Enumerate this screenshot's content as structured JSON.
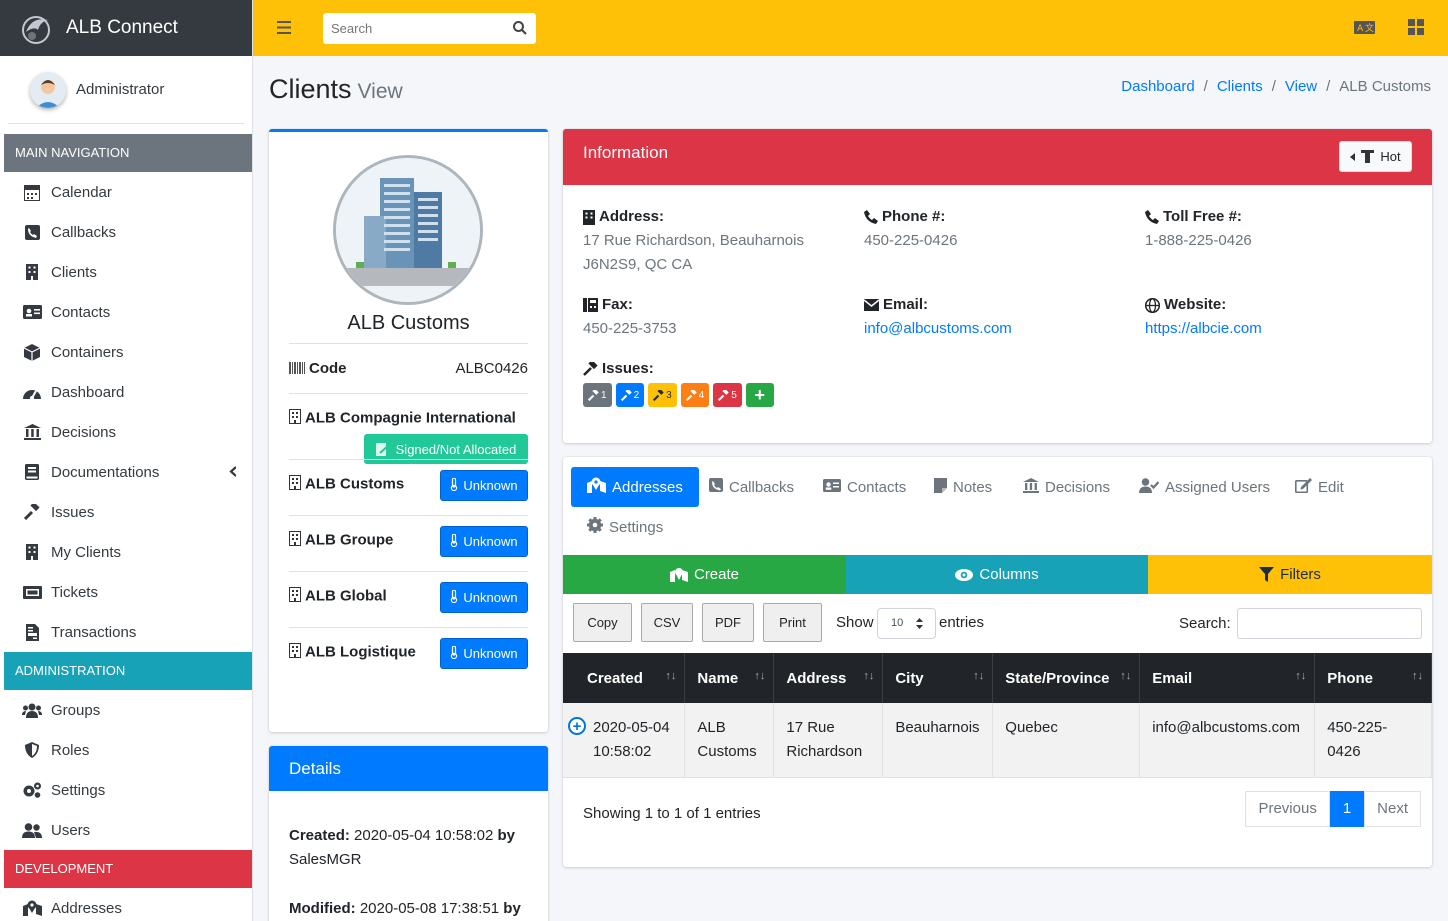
{
  "app": {
    "title": "ALB Connect"
  },
  "user": {
    "name": "Administrator"
  },
  "sidebar": {
    "main_header": "MAIN NAVIGATION",
    "main_items": [
      {
        "label": "Calendar",
        "icon": "calendar-icon"
      },
      {
        "label": "Callbacks",
        "icon": "phone-square-icon"
      },
      {
        "label": "Clients",
        "icon": "building-icon"
      },
      {
        "label": "Contacts",
        "icon": "id-card-icon"
      },
      {
        "label": "Containers",
        "icon": "box-icon"
      },
      {
        "label": "Dashboard",
        "icon": "tachometer-icon"
      },
      {
        "label": "Decisions",
        "icon": "landmark-icon"
      },
      {
        "label": "Documentations",
        "icon": "book-icon"
      },
      {
        "label": "Issues",
        "icon": "gavel-icon"
      },
      {
        "label": "My Clients",
        "icon": "building-icon"
      },
      {
        "label": "Tickets",
        "icon": "ticket-icon"
      },
      {
        "label": "Transactions",
        "icon": "file-invoice-icon"
      }
    ],
    "admin_header": "ADMINISTRATION",
    "admin_items": [
      {
        "label": "Groups",
        "icon": "users-icon"
      },
      {
        "label": "Roles",
        "icon": "shield-icon"
      },
      {
        "label": "Settings",
        "icon": "cogs-icon"
      },
      {
        "label": "Users",
        "icon": "user-friends-icon"
      }
    ],
    "dev_header": "DEVELOPMENT",
    "dev_items": [
      {
        "label": "Addresses",
        "icon": "map-marked-icon"
      }
    ]
  },
  "topbar": {
    "search_placeholder": "Search"
  },
  "page": {
    "title": "Clients",
    "subtitle": "View"
  },
  "breadcrumb": [
    "Dashboard",
    "Clients",
    "View",
    "ALB Customs"
  ],
  "profile": {
    "name": "ALB Customs",
    "code_label": "Code",
    "code_value": "ALBC0426",
    "parent": "ALB Compagnie International",
    "parent_status": "Signed/Not Allocated",
    "related": [
      {
        "name": "ALB Customs",
        "status": "Unknown"
      },
      {
        "name": "ALB Groupe",
        "status": "Unknown"
      },
      {
        "name": "ALB Global",
        "status": "Unknown"
      },
      {
        "name": "ALB Logistique",
        "status": "Unknown"
      }
    ]
  },
  "details": {
    "title": "Details",
    "created_label": "Created:",
    "created_value": "2020-05-04 10:58:02",
    "created_by_label": "by",
    "created_by": "SalesMGR",
    "modified_label": "Modified:",
    "modified_value": "2020-05-08 17:38:51",
    "modified_by_label": "by"
  },
  "info": {
    "title": "Information",
    "hot_label": "Hot",
    "address_label": "Address:",
    "address_line1": "17 Rue Richardson, Beauharnois",
    "address_line2": "J6N2S9, QC CA",
    "phone_label": "Phone #:",
    "phone": "450-225-0426",
    "tollfree_label": "Toll Free #:",
    "tollfree": "1-888-225-0426",
    "fax_label": "Fax:",
    "fax": "450-225-3753",
    "email_label": "Email:",
    "email": "info@albcustoms.com",
    "website_label": "Website:",
    "website": "https://albcie.com",
    "issues_label": "Issues:",
    "issues": [
      {
        "n": "1",
        "color": "#6c757d"
      },
      {
        "n": "2",
        "color": "#007bff"
      },
      {
        "n": "3",
        "color": "#ffc107"
      },
      {
        "n": "4",
        "color": "#fd7e14"
      },
      {
        "n": "5",
        "color": "#dc3545"
      }
    ],
    "issue_add": "+"
  },
  "tabs": {
    "items": [
      "Addresses",
      "Callbacks",
      "Contacts",
      "Notes",
      "Decisions",
      "Assigned Users",
      "Edit",
      "Settings"
    ],
    "active": "Addresses",
    "actions": {
      "create": "Create",
      "columns": "Columns",
      "filters": "Filters"
    },
    "buttons": [
      "Copy",
      "CSV",
      "PDF",
      "Print"
    ],
    "show_label": "Show",
    "page_size": "10",
    "entries_label": "entries",
    "search_label": "Search:",
    "columns": [
      "Created",
      "Name",
      "Address",
      "City",
      "State/Province",
      "Email",
      "Phone"
    ],
    "rows": [
      {
        "created_line1": "2020-05-04",
        "created_line2": "10:58:02",
        "name_line1": "ALB",
        "name_line2": "Customs",
        "address_line1": "17 Rue",
        "address_line2": "Richardson",
        "city": "Beauharnois",
        "state": "Quebec",
        "email": "info@albcustoms.com",
        "phone": "450-225-0426"
      }
    ],
    "info_text": "Showing 1 to 1 of 1 entries",
    "pager": {
      "prev": "Previous",
      "current": "1",
      "next": "Next"
    }
  },
  "colors": {
    "topbar": "#ffc107",
    "brand": "#343a40",
    "primary": "#007bff",
    "danger": "#dc3545",
    "info": "#17a2b8",
    "success": "#28a745"
  }
}
